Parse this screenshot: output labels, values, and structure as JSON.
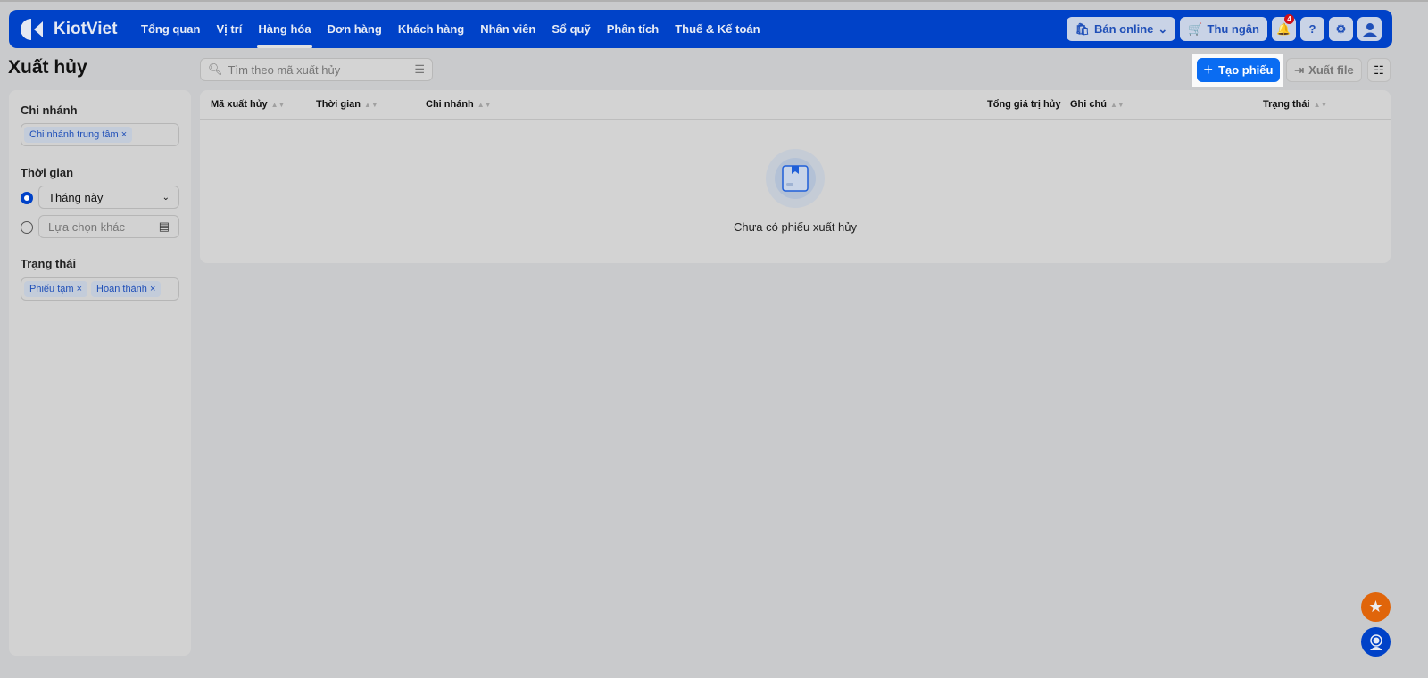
{
  "nav": {
    "brand": "KiotViet",
    "items": [
      "Tổng quan",
      "Vị trí",
      "Hàng hóa",
      "Đơn hàng",
      "Khách hàng",
      "Nhân viên",
      "Sổ quỹ",
      "Phân tích",
      "Thuế & Kế toán"
    ],
    "active": "Hàng hóa",
    "online_label": "Bán online",
    "cashier_label": "Thu ngân",
    "notification_count": "4"
  },
  "page": {
    "title": "Xuất hủy",
    "search_placeholder": "Tìm theo mã xuất hủy",
    "create_label": "Tạo phiếu",
    "export_label": "Xuất file"
  },
  "filters": {
    "branch_label": "Chi nhánh",
    "branch_tags": [
      "Chi nhánh trung tâm"
    ],
    "time_label": "Thời gian",
    "time_option": "Tháng này",
    "time_other": "Lựa chọn khác",
    "status_label": "Trạng thái",
    "status_tags": [
      "Phiếu tạm",
      "Hoàn thành"
    ]
  },
  "table": {
    "columns": [
      "Mã xuất hủy",
      "Thời gian",
      "Chi nhánh",
      "Tổng giá trị hủy",
      "Ghi chú",
      "Trạng thái"
    ],
    "empty_text": "Chưa có phiếu xuất hủy"
  },
  "colors": {
    "brand": "#0042c8",
    "primary": "#0a6cf2",
    "favorite": "#e0650a"
  }
}
